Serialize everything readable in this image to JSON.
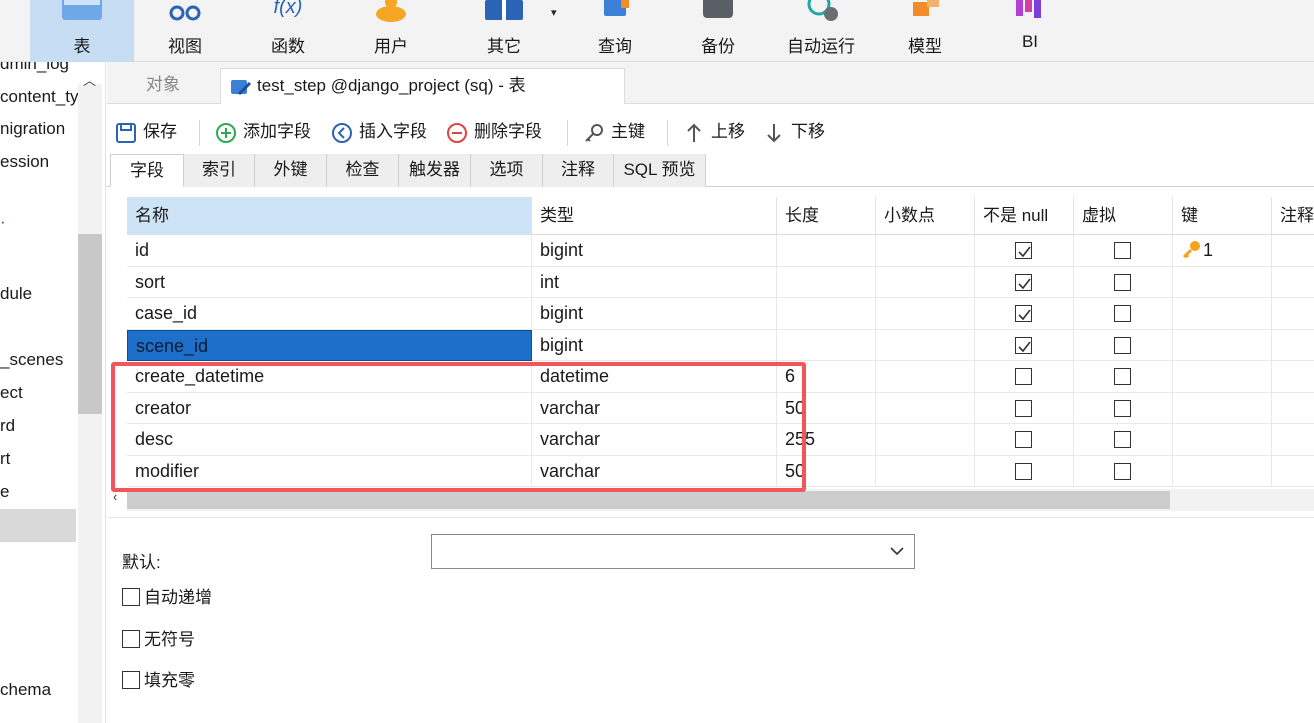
{
  "ribbon": {
    "items": [
      {
        "label": "表",
        "icon": "table-icon"
      },
      {
        "label": "视图",
        "icon": "view-icon"
      },
      {
        "label": "函数",
        "icon": "function-icon"
      },
      {
        "label": "用户",
        "icon": "user-icon"
      },
      {
        "label": "其它",
        "icon": "other-icon"
      },
      {
        "label": "查询",
        "icon": "query-icon"
      },
      {
        "label": "备份",
        "icon": "backup-icon"
      },
      {
        "label": "自动运行",
        "icon": "automation-icon"
      },
      {
        "label": "模型",
        "icon": "model-icon"
      },
      {
        "label": "BI",
        "icon": "bi-icon"
      }
    ],
    "dropdown_glyph": "▾",
    "function_glyph": "f(x)"
  },
  "tree": {
    "items": [
      "dmin_log",
      "content_ty",
      "nigration",
      "ession",
      "dule",
      "_scenes",
      "ect",
      "rd",
      "rt",
      "e",
      "chema"
    ]
  },
  "doc_tabs": {
    "objects": "对象",
    "table": "test_step @django_project (sq) - 表"
  },
  "toolbar": {
    "save": "保存",
    "add_field": "添加字段",
    "insert_field": "插入字段",
    "delete_field": "删除字段",
    "primary_key": "主键",
    "move_up": "上移",
    "move_down": "下移"
  },
  "sub_tabs": [
    "字段",
    "索引",
    "外键",
    "检查",
    "触发器",
    "选项",
    "注释",
    "SQL 预览"
  ],
  "grid": {
    "headers": [
      "名称",
      "类型",
      "长度",
      "小数点",
      "不是 null",
      "虚拟",
      "键",
      "注释"
    ],
    "rows": [
      {
        "name": "id",
        "type": "bigint",
        "length": "",
        "decimals": "",
        "not_null": true,
        "virtual": false,
        "key": "1"
      },
      {
        "name": "sort",
        "type": "int",
        "length": "",
        "decimals": "",
        "not_null": true,
        "virtual": false,
        "key": ""
      },
      {
        "name": "case_id",
        "type": "bigint",
        "length": "",
        "decimals": "",
        "not_null": true,
        "virtual": false,
        "key": ""
      },
      {
        "name": "scene_id",
        "type": "bigint",
        "length": "",
        "decimals": "",
        "not_null": true,
        "virtual": false,
        "key": ""
      },
      {
        "name": "create_datetime",
        "type": "datetime",
        "length": "6",
        "decimals": "",
        "not_null": false,
        "virtual": false,
        "key": ""
      },
      {
        "name": "creator",
        "type": "varchar",
        "length": "50",
        "decimals": "",
        "not_null": false,
        "virtual": false,
        "key": ""
      },
      {
        "name": "desc",
        "type": "varchar",
        "length": "255",
        "decimals": "",
        "not_null": false,
        "virtual": false,
        "key": ""
      },
      {
        "name": "modifier",
        "type": "varchar",
        "length": "50",
        "decimals": "",
        "not_null": false,
        "virtual": false,
        "key": ""
      }
    ]
  },
  "props": {
    "default_label": "默认:",
    "default_value": "",
    "auto_increment": "自动递增",
    "unsigned": "无符号",
    "zerofill": "填充零"
  },
  "colors": {
    "selection": "#1e6fc9",
    "highlight_box": "#f0565a",
    "ribbon_active": "#c6ddf4"
  }
}
